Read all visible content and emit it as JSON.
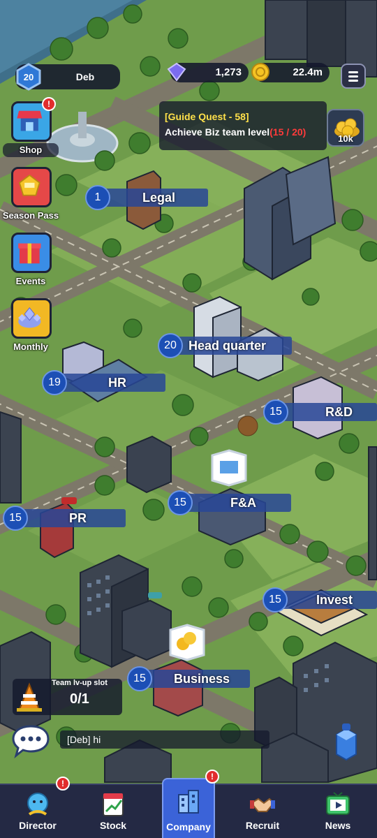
{
  "player": {
    "level": "20",
    "name": "Deb"
  },
  "currency": {
    "gems": "1,273",
    "gold": "22.4m"
  },
  "quest": {
    "title": "[Guide Quest - 58]",
    "text": "Achieve Biz team level",
    "progress": "(15 / 20)",
    "reward": "10k"
  },
  "side_menu": [
    {
      "label": "Shop",
      "badge": "!"
    },
    {
      "label": "Season Pass"
    },
    {
      "label": "Events"
    },
    {
      "label": "Monthly"
    }
  ],
  "departments": [
    {
      "level": "1",
      "name": "Legal"
    },
    {
      "level": "20",
      "name": "Head quarter"
    },
    {
      "level": "19",
      "name": "HR"
    },
    {
      "level": "15",
      "name": "R&D"
    },
    {
      "level": "15",
      "name": "F&A"
    },
    {
      "level": "15",
      "name": "PR"
    },
    {
      "level": "15",
      "name": "Invest"
    },
    {
      "level": "15",
      "name": "Business"
    }
  ],
  "team_slot": {
    "title": "Team lv-up slot",
    "value": "0/1"
  },
  "chat": {
    "message": "[Deb] hi"
  },
  "nav": [
    {
      "label": "Director",
      "badge": "!"
    },
    {
      "label": "Stock"
    },
    {
      "label": "Company",
      "badge": "!",
      "active": true
    },
    {
      "label": "Recruit"
    },
    {
      "label": "News"
    }
  ],
  "colors": {
    "grass": "#6d9a4a",
    "road": "#7c7768",
    "hud": "#14182c",
    "dept_bar": "#284696",
    "nav_active": "#3b63d8",
    "quest_title": "#ffe04a",
    "quest_progress": "#ff3b3b"
  }
}
